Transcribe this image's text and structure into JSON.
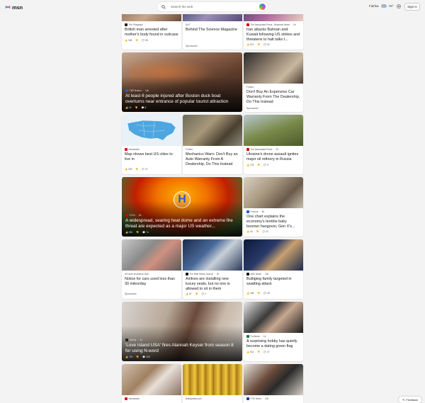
{
  "header": {
    "logo_text": "msn",
    "search_placeholder": "Search the web",
    "location": "Fairfax",
    "temperature": "76°",
    "signin_label": "Sign in"
  },
  "cards": [
    {
      "id": "c1",
      "source": "The Telegraph",
      "time": "",
      "title": "British man arrested after mother's body found in suitcase",
      "likes": "168",
      "comments": "96",
      "sponsored": ""
    },
    {
      "id": "c2",
      "source": "SciT",
      "time": "",
      "title": "Behind The Science Magazine",
      "likes": "",
      "comments": "",
      "sponsored": "Sponsored"
    },
    {
      "id": "c3",
      "source": "The Associated Press - Business News",
      "time": "3h",
      "title": "Iran attacks Bahrain and Kuwait following US strikes and threatens to halt talks t...",
      "likes": "574",
      "comments": "61",
      "sponsored": ""
    },
    {
      "id": "c4",
      "source": "CBS Boston",
      "time": "14h",
      "title": "At least 6 people injured after Boston duck boat overturns near entrance of popular tourist attraction",
      "likes": "24",
      "comments": "8",
      "sponsored": ""
    },
    {
      "id": "c5",
      "source": "Forbes",
      "time": "",
      "title": "Don't Buy An Expensive Car Warranty From The Dealership, Do This Instead",
      "likes": "",
      "comments": "",
      "sponsored": "Sponsored"
    },
    {
      "id": "c6",
      "source": "Newsweek",
      "time": "",
      "title": "Map shows best US cities to live in",
      "likes": "209",
      "comments": "37",
      "sponsored": ""
    },
    {
      "id": "c7",
      "source": "Forbes",
      "time": "",
      "title": "Mechanics Warn: Don't Buy an Auto Warranty From A Dealership, Do This Instead",
      "likes": "",
      "comments": "",
      "sponsored": "Sponsored"
    },
    {
      "id": "c8",
      "source": "The Associated Press",
      "time": "2h",
      "title": "Ukraine's drone assault ignites major oil refinery in Russia",
      "likes": "178",
      "comments": "9",
      "sponsored": ""
    },
    {
      "id": "c9",
      "source": "FOX4",
      "time": "5h",
      "title": "A widespread, searing heat dome and an extreme fire threat are expected as a major US weather...",
      "likes": "891",
      "comments": "74",
      "sponsored": ""
    },
    {
      "id": "c10",
      "source": "Fortune",
      "time": "5h",
      "title": "One chart explains the economy's terrible baby boomer hangover, Gen X's...",
      "likes": "40",
      "comments": "22",
      "sponsored": ""
    },
    {
      "id": "c11",
      "source": "US Auto Insurance Now",
      "time": "",
      "title": "Notice for cars used less than 30 miles/day",
      "likes": "",
      "comments": "",
      "sponsored": "Sponsored"
    },
    {
      "id": "c12",
      "source": "The Wall Street Journal",
      "time": "3h",
      "title": "Airlines are installing new luxury seats, but no one is allowed to sit in them",
      "likes": "57",
      "comments": "1",
      "sponsored": ""
    },
    {
      "id": "c13",
      "source": "ABC News",
      "time": "13h",
      "title": "Buttigieg family targeted in swatting attack",
      "likes": "188",
      "comments": "93",
      "sponsored": ""
    },
    {
      "id": "c14",
      "source": "Variety",
      "time": "4d",
      "title": "'Love Island USA' fires Alannah Keyser from season 8 for using N-word",
      "likes": "719",
      "comments": "308",
      "sponsored": ""
    },
    {
      "id": "c15",
      "source": "FoxNews",
      "time": "1d",
      "title": "A surprising hobby has quietly become a dating green flag",
      "likes": "514",
      "comments": "47",
      "sponsored": ""
    },
    {
      "id": "c16",
      "source": "Newsweek",
      "time": "",
      "title": "",
      "likes": "",
      "comments": "",
      "sponsored": ""
    },
    {
      "id": "c17",
      "source": "Ballotpedia.com",
      "time": "",
      "title": "",
      "likes": "",
      "comments": "",
      "sponsored": ""
    },
    {
      "id": "c18",
      "source": "FOX News",
      "time": "10h",
      "title": "",
      "likes": "",
      "comments": "",
      "sponsored": ""
    }
  ],
  "feedback_label": "Feedback"
}
